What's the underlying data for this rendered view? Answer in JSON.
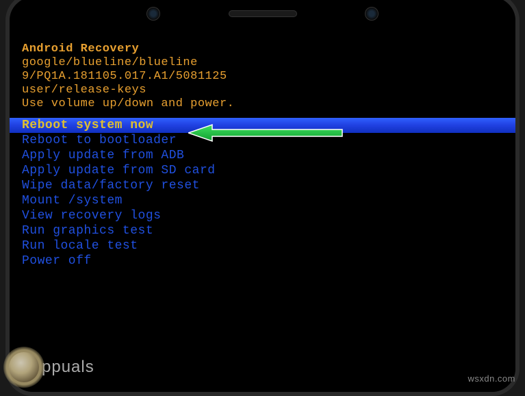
{
  "header": {
    "title": "Android Recovery",
    "device": "google/blueline/blueline",
    "build": "9/PQ1A.181105.017.A1/5081125",
    "keys": "user/release-keys",
    "instructions": "Use volume up/down and power."
  },
  "menu": {
    "items": [
      {
        "label": "Reboot system now",
        "selected": true
      },
      {
        "label": "Reboot to bootloader",
        "selected": false
      },
      {
        "label": "Apply update from ADB",
        "selected": false
      },
      {
        "label": "Apply update from SD card",
        "selected": false
      },
      {
        "label": "Wipe data/factory reset",
        "selected": false
      },
      {
        "label": "Mount /system",
        "selected": false
      },
      {
        "label": "View recovery logs",
        "selected": false
      },
      {
        "label": "Run graphics test",
        "selected": false
      },
      {
        "label": "Run locale test",
        "selected": false
      },
      {
        "label": "Power off",
        "selected": false
      }
    ]
  },
  "watermark": {
    "brand": "ppuals",
    "site": "wsxdn.com"
  }
}
